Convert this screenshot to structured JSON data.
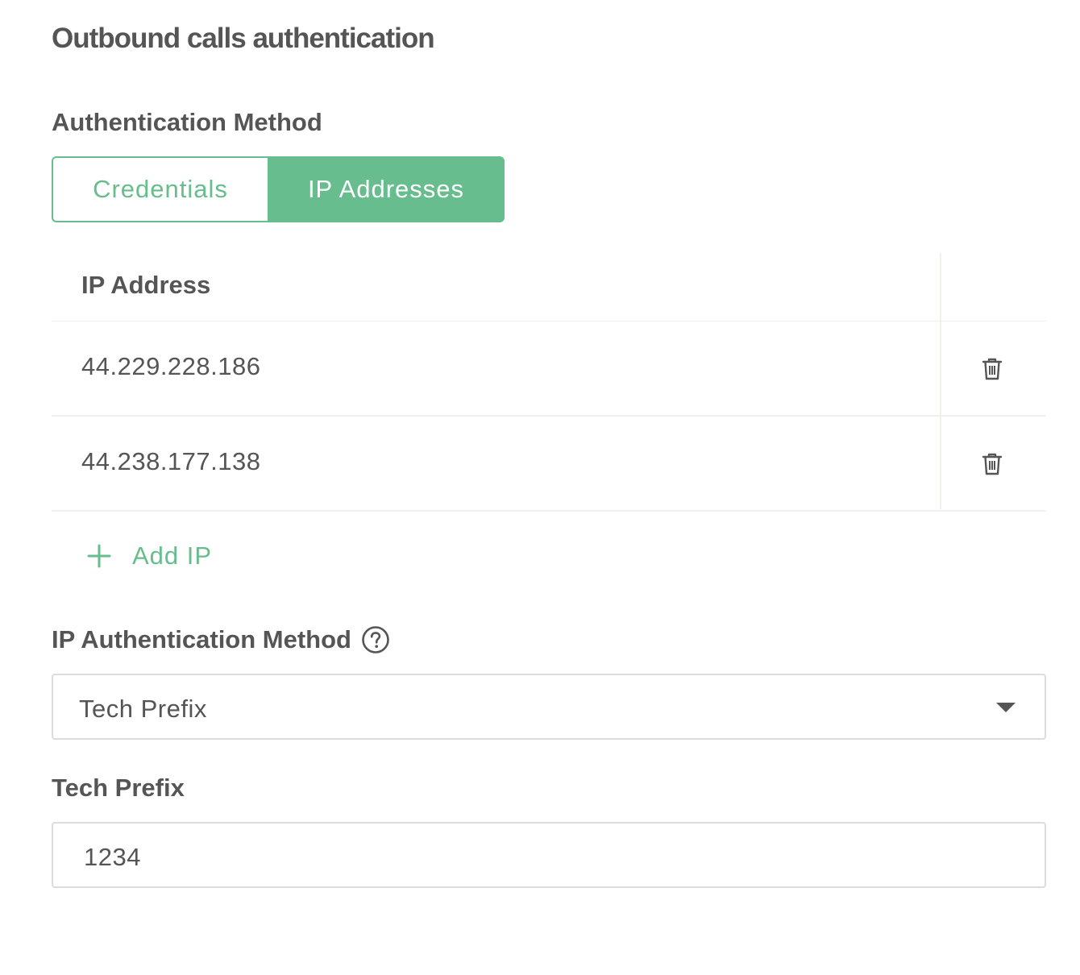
{
  "page": {
    "title": "Outbound calls authentication"
  },
  "auth_method": {
    "label": "Authentication Method",
    "options": [
      {
        "label": "Credentials",
        "selected": false
      },
      {
        "label": "IP Addresses",
        "selected": true
      }
    ],
    "accent_color": "#67bd8d"
  },
  "ip_table": {
    "header": "IP Address",
    "rows": [
      {
        "ip": "44.229.228.186",
        "action_icon": "trash-icon"
      },
      {
        "ip": "44.238.177.138",
        "action_icon": "trash-icon"
      }
    ],
    "add_label": "Add IP",
    "add_icon": "plus-icon"
  },
  "ip_auth_method": {
    "label": "IP Authentication Method",
    "help_icon": "question-circle-icon",
    "selected": "Tech Prefix"
  },
  "tech_prefix": {
    "label": "Tech Prefix",
    "value": "1234"
  }
}
